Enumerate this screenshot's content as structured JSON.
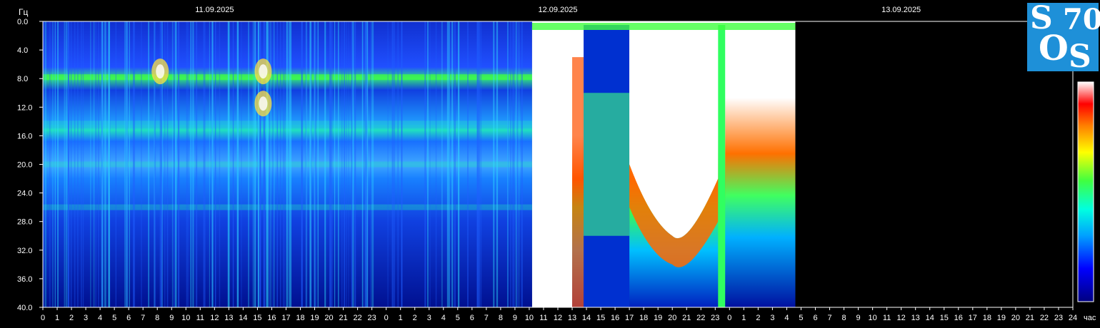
{
  "chart_data": {
    "type": "heatmap",
    "y_unit": "Гц",
    "x_unit": "час",
    "dates": [
      "11.09.2025",
      "12.09.2025",
      "13.09.2025"
    ],
    "ylim": [
      0,
      40
    ],
    "y_ticks": [
      "0.0",
      "4.0",
      "8.0",
      "12.0",
      "16.0",
      "20.0",
      "24.0",
      "28.0",
      "32.0",
      "36.0",
      "40.0"
    ],
    "x_ticks": [
      "0",
      "1",
      "2",
      "3",
      "4",
      "5",
      "6",
      "7",
      "8",
      "9",
      "10",
      "11",
      "12",
      "13",
      "14",
      "15",
      "16",
      "17",
      "18",
      "19",
      "20",
      "21",
      "22",
      "23",
      "0",
      "1",
      "2",
      "3",
      "4",
      "5",
      "6",
      "7",
      "8",
      "9",
      "10",
      "11",
      "12",
      "13",
      "14",
      "15",
      "16",
      "17",
      "18",
      "19",
      "20",
      "21",
      "22",
      "23",
      "0",
      "1",
      "2",
      "3",
      "4",
      "5",
      "6",
      "7",
      "8",
      "9",
      "10",
      "11",
      "12",
      "13",
      "14",
      "15",
      "16",
      "17",
      "18",
      "19",
      "20",
      "21",
      "22",
      "23",
      "24"
    ],
    "hours_total": 72,
    "data_end_hour": 52.6,
    "colorscale": [
      "#000080",
      "#0000ff",
      "#00a0ff",
      "#00ffe0",
      "#40ff40",
      "#ffff00",
      "#ff8000",
      "#ff0000",
      "#ffffff"
    ],
    "series": [
      {
        "start_hour": 0,
        "end_hour": 34.2,
        "intensity": "low-moderate",
        "bands_hz": [
          7.8,
          14.3,
          20.0,
          26.0
        ]
      },
      {
        "start_hour": 34.2,
        "end_hour": 52.6,
        "intensity": "very high",
        "bands_hz": [
          0,
          40
        ]
      }
    ]
  },
  "logo": {
    "line1_left": "S",
    "line1_right": "70",
    "line2_left": "O",
    "line2_right": "S"
  },
  "colors": {
    "background": "#000000",
    "axis": "#ffffff",
    "logo_bg": "#1e90d8"
  }
}
